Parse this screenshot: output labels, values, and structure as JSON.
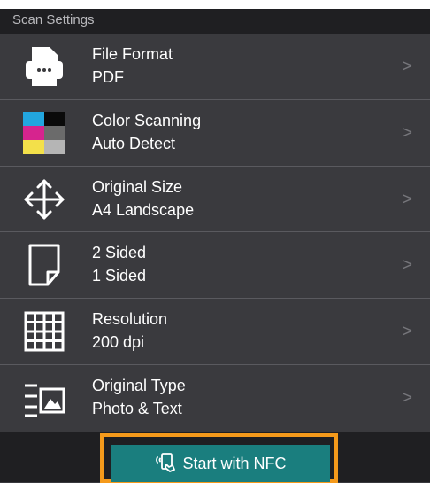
{
  "header": {
    "title": "Scan Settings"
  },
  "settings": [
    {
      "label": "File Format",
      "value": "PDF",
      "icon": "file-format-icon"
    },
    {
      "label": "Color Scanning",
      "value": "Auto Detect",
      "icon": "color-scanning-icon"
    },
    {
      "label": "Original Size",
      "value": "A4 Landscape",
      "icon": "original-size-icon"
    },
    {
      "label": "2 Sided",
      "value": "1 Sided",
      "icon": "two-sided-icon"
    },
    {
      "label": "Resolution",
      "value": "200 dpi",
      "icon": "resolution-icon"
    },
    {
      "label": "Original Type",
      "value": "Photo & Text",
      "icon": "original-type-icon"
    }
  ],
  "chevron": ">",
  "nfc_button": {
    "label": "Start with NFC",
    "icon": "nfc-icon"
  },
  "colors": {
    "accent": "#1a7e7e",
    "highlight": "#f59a1b",
    "background": "#3a3a3e",
    "header": "#1f1f22"
  }
}
